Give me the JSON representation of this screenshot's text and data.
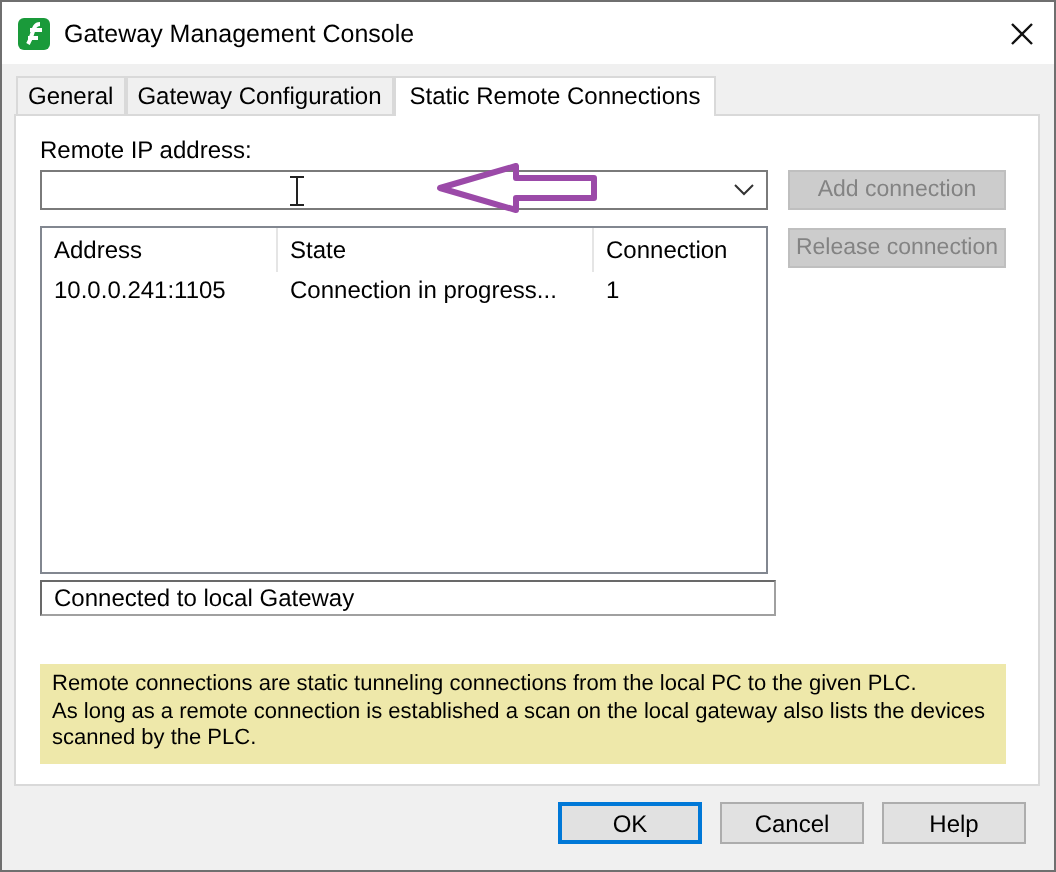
{
  "window": {
    "title": "Gateway Management Console"
  },
  "tabs": [
    {
      "label": "General",
      "selected": false
    },
    {
      "label": "Gateway Configuration",
      "selected": false
    },
    {
      "label": "Static Remote Connections",
      "selected": true
    }
  ],
  "remote_ip": {
    "label": "Remote IP address:"
  },
  "side_buttons": [
    {
      "label": "Add connection",
      "disabled": true
    },
    {
      "label": "Release connection",
      "disabled": true
    }
  ],
  "table": {
    "columns": [
      "Address",
      "State",
      "Connection"
    ],
    "rows": [
      {
        "cells": [
          "10.0.0.241:1105",
          "Connection in progress...",
          "1"
        ],
        "selected": false
      }
    ]
  },
  "status": {
    "value": "Connected to local Gateway"
  },
  "info": [
    "Remote connections are static tunneling connections from the local PC to the given PLC.",
    "As long as a remote connection is established a scan on the local gateway also lists the devices scanned by the PLC."
  ],
  "buttons": [
    {
      "label": "OK",
      "default": true
    },
    {
      "label": "Cancel",
      "default": false
    },
    {
      "label": "Help",
      "default": false
    }
  ]
}
